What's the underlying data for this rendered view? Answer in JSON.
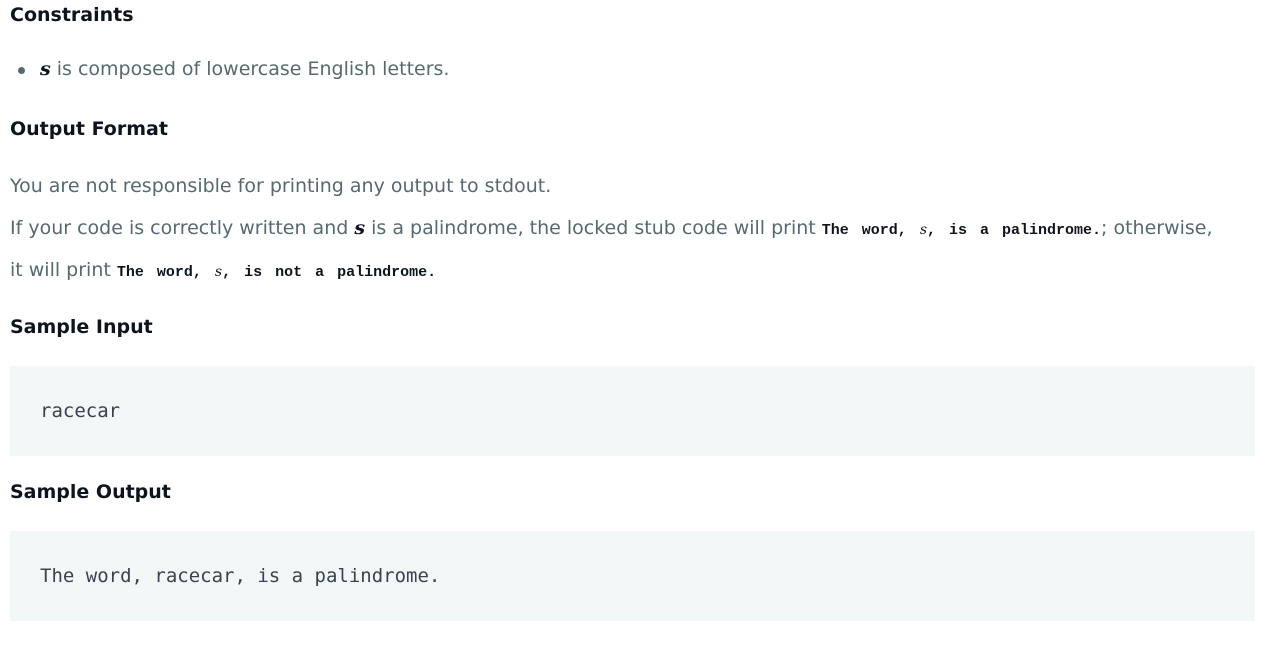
{
  "constraints": {
    "heading": "Constraints",
    "items": [
      {
        "var": "s",
        "text": " is composed of lowercase English letters."
      }
    ]
  },
  "output_format": {
    "heading": "Output Format",
    "line1": "You are not responsible for printing any output to stdout.",
    "line2": {
      "part1": "If your code is correctly written and ",
      "var": "s",
      "part2": " is a palindrome, the locked stub code will print ",
      "code_before": "The word, ",
      "code_var": "s",
      "code_after": ", is a palindrome.",
      "part3": "; otherwise,"
    },
    "line3": {
      "part1": "it will print ",
      "code_before": "The word, ",
      "code_var": "s",
      "code_after": ", is not a palindrome."
    }
  },
  "sample_input": {
    "heading": "Sample Input",
    "code": "racecar"
  },
  "sample_output": {
    "heading": "Sample Output",
    "code": "The word, racecar, is a palindrome."
  }
}
